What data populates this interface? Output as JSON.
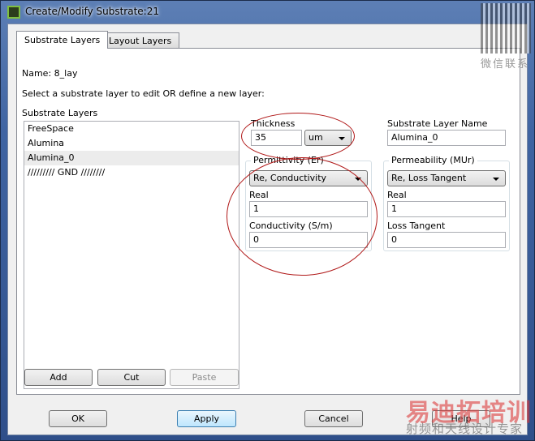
{
  "window": {
    "title": "Create/Modify Substrate:21"
  },
  "tabs": [
    {
      "label": "Substrate Layers",
      "active": true
    },
    {
      "label": "Layout Layers",
      "active": false
    }
  ],
  "name_label": "Name: 8_lay",
  "instruction": "Select a substrate layer to edit OR define a new layer:",
  "layers_label": "Substrate Layers",
  "layers": [
    {
      "label": "FreeSpace"
    },
    {
      "label": "Alumina"
    },
    {
      "label": "Alumina_0",
      "selected": true
    },
    {
      "label": "///////// GND ////////"
    }
  ],
  "list_buttons": {
    "add": "Add",
    "cut": "Cut",
    "paste": "Paste"
  },
  "thickness": {
    "label": "Thickness",
    "value": "35",
    "unit": "um"
  },
  "layer_name": {
    "label": "Substrate Layer Name",
    "value": "Alumina_0"
  },
  "permittivity": {
    "label": "Permittivity (Er)",
    "mode": "Re, Conductivity",
    "real_label": "Real",
    "real": "1",
    "second_label": "Conductivity (S/m)",
    "second": "0"
  },
  "permeability": {
    "label": "Permeability (MUr)",
    "mode": "Re, Loss Tangent",
    "real_label": "Real",
    "real": "1",
    "second_label": "Loss Tangent",
    "second": "0"
  },
  "footer": {
    "ok": "OK",
    "apply": "Apply",
    "cancel": "Cancel",
    "help": "Help"
  },
  "watermark": {
    "line1": "易迪拓培训",
    "line2": "射频和天线设计专家",
    "qr_caption": "微信联系"
  }
}
